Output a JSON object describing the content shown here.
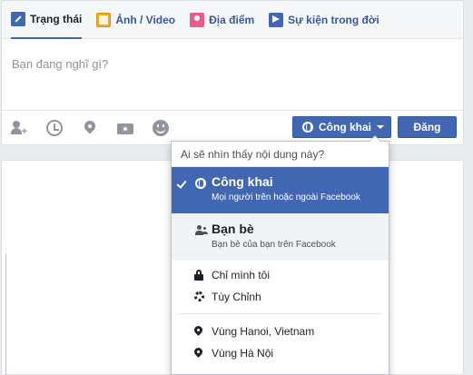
{
  "composer": {
    "tabs": [
      {
        "label": "Trạng thái",
        "icon": "pencil-icon"
      },
      {
        "label": "Ảnh / Video",
        "icon": "photo-icon"
      },
      {
        "label": "Địa điểm",
        "icon": "place-icon"
      },
      {
        "label": "Sự kiện trong đời",
        "icon": "life-event-icon"
      }
    ],
    "placeholder": "Bạn đang nghĩ gì?",
    "action_icons": [
      "tag-friends-icon",
      "clock-icon",
      "location-pin-icon",
      "camera-icon",
      "emoji-icon"
    ],
    "tag_plus": "+",
    "privacy_button": "Công khai",
    "post_button": "Đăng"
  },
  "privacy_menu": {
    "header": "Ai sẽ nhìn thấy nội dung này?",
    "options": [
      {
        "title": "Công khai",
        "subtitle": "Mọi người trên hoặc ngoài Facebook",
        "icon": "globe-icon",
        "selected": true
      },
      {
        "title": "Bạn bè",
        "subtitle": "Bạn bè của bạn trên Facebook",
        "icon": "friends-icon",
        "selected": false
      }
    ],
    "more": [
      {
        "label": "Chỉ mình tôi",
        "icon": "lock-icon"
      },
      {
        "label": "Tùy Chỉnh",
        "icon": "gear-icon"
      }
    ],
    "locations": [
      {
        "label": "Vùng Hanoi, Vietnam",
        "icon": "location-pin-icon"
      },
      {
        "label": "Vùng Hà Nội",
        "icon": "location-pin-icon"
      }
    ]
  },
  "colors": {
    "brand_blue": "#4267b2",
    "background": "#e9ebee",
    "muted_text": "#90949c"
  }
}
